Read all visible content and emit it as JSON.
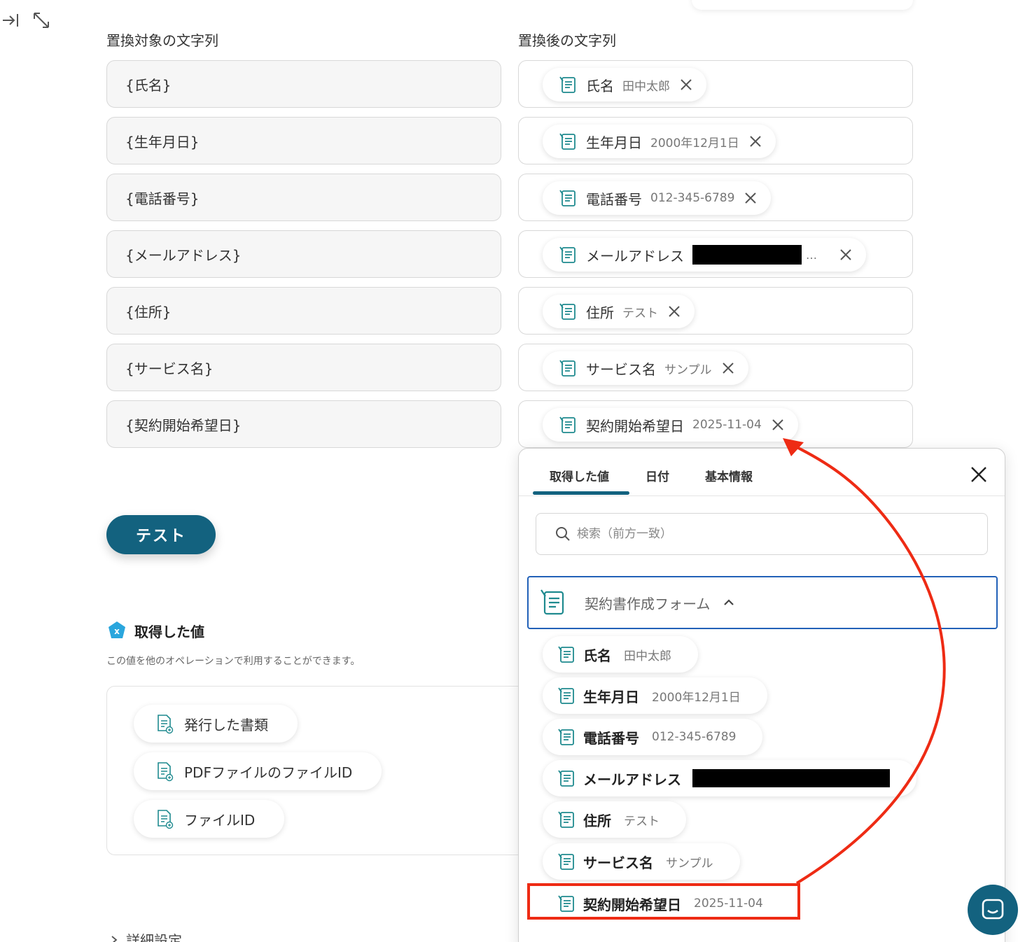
{
  "headers": {
    "source": "置換対象の文字列",
    "target": "置換後の文字列"
  },
  "rows": [
    {
      "source": "{氏名}",
      "label": "氏名",
      "value": "田中太郎"
    },
    {
      "source": "{生年月日}",
      "label": "生年月日",
      "value": "2000年12月1日"
    },
    {
      "source": "{電話番号}",
      "label": "電話番号",
      "value": "012-345-6789"
    },
    {
      "source": "{メールアドレス}",
      "label": "メールアドレス",
      "value": "…",
      "redacted": true
    },
    {
      "source": "{住所}",
      "label": "住所",
      "value": "テスト"
    },
    {
      "source": "{サービス名}",
      "label": "サービス名",
      "value": "サンプル"
    },
    {
      "source": "{契約開始希望日}",
      "label": "契約開始希望日",
      "value": "2025-11-04"
    }
  ],
  "test_button": "テスト",
  "acquired": {
    "title": "取得した値",
    "badge": "x",
    "description": "この値を他のオペレーションで利用することができます。",
    "items": [
      "発行した書類",
      "PDFファイルのファイルID",
      "ファイルID"
    ]
  },
  "detail_label": "詳細設定",
  "panel": {
    "tabs": [
      "取得した値",
      "日付",
      "基本情報"
    ],
    "active_tab": "取得した値",
    "search_placeholder": "検索（前方一致）",
    "group_name": "契約書作成フォーム",
    "options": [
      {
        "label": "氏名",
        "value": "田中太郎"
      },
      {
        "label": "生年月日",
        "value": "2000年12月1日"
      },
      {
        "label": "電話番号",
        "value": "012-345-6789"
      },
      {
        "label": "メールアドレス",
        "value": "",
        "redacted": true
      },
      {
        "label": "住所",
        "value": "テスト"
      },
      {
        "label": "サービス名",
        "value": "サンプル"
      },
      {
        "label": "契約開始希望日",
        "value": "2025-11-04"
      }
    ]
  },
  "colors": {
    "primary": "#13627f",
    "annotation": "#ee2b14",
    "group_border": "#2261b8",
    "icon_teal": "#1f8a8f"
  }
}
